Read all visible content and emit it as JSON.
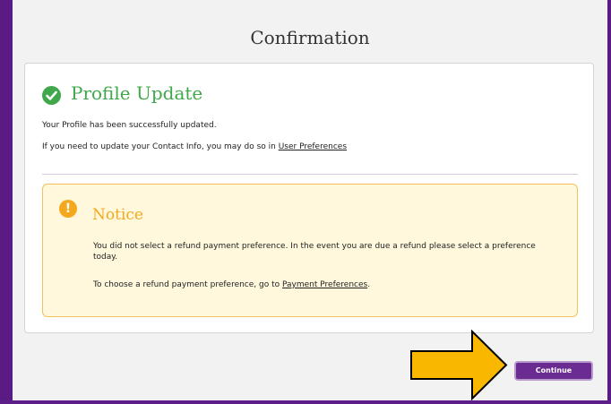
{
  "page": {
    "title": "Confirmation"
  },
  "success": {
    "title": "Profile Update",
    "icon": "check-circle-icon",
    "color": "#3fa84a",
    "message": "Your Profile has been successfully updated.",
    "contact_text": "If you need to update your Contact Info, you may do so in ",
    "contact_link": "User Preferences"
  },
  "notice": {
    "title": "Notice",
    "icon": "exclamation-circle-icon",
    "color": "#f4a81d",
    "text": "You did not select a refund payment preference. In the event you are due a refund please select a preference today.",
    "choose_text": "To choose a refund payment preference, go to ",
    "choose_link": "Payment Preferences",
    "choose_suffix": "."
  },
  "actions": {
    "continue_label": "Continue",
    "continue_color": "#6a2c91",
    "pointer_icon": "arrow-right-icon",
    "pointer_color": "#f9b700"
  }
}
